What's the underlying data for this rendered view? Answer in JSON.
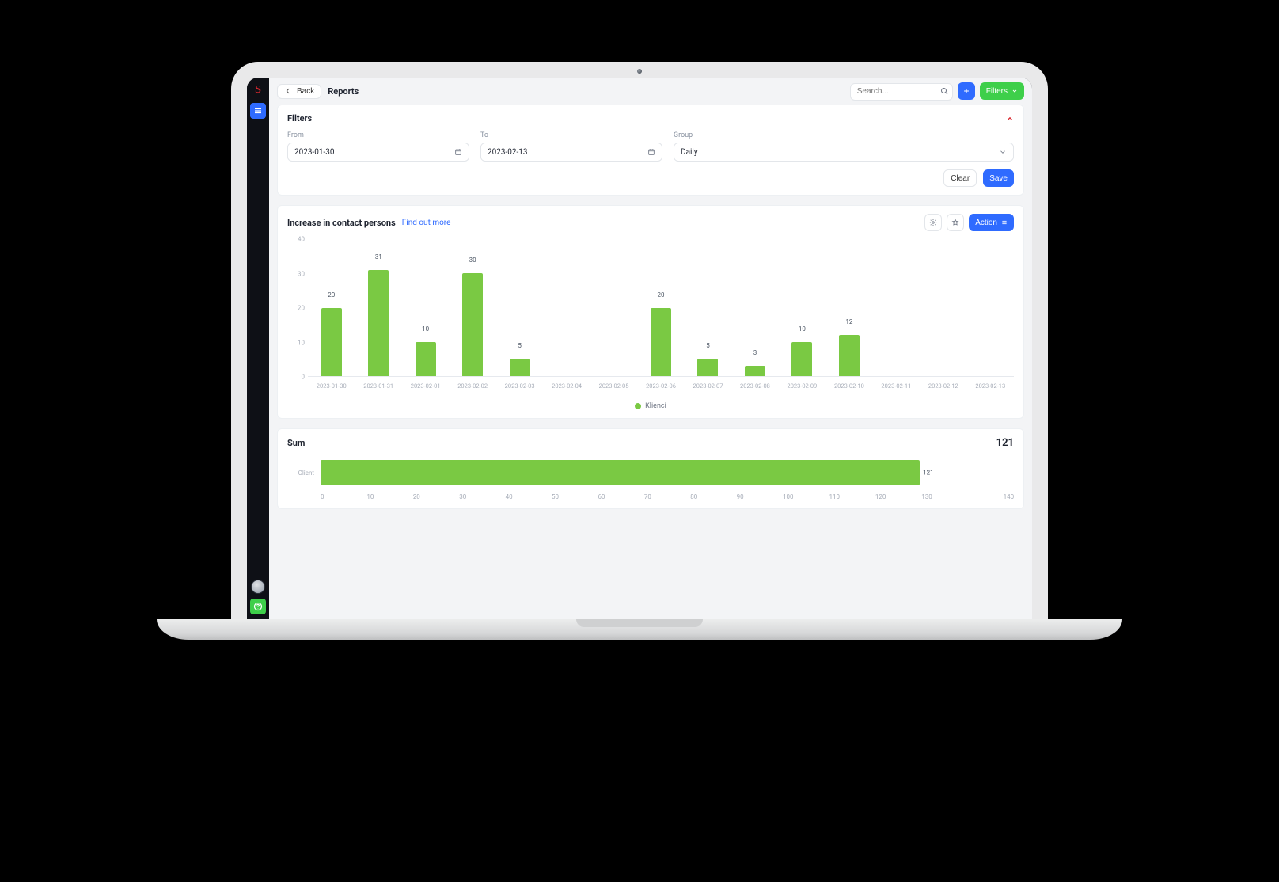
{
  "header": {
    "back_label": "Back",
    "breadcrumb": "Reports",
    "search_placeholder": "Search...",
    "filters_button": "Filters"
  },
  "filters_card": {
    "title": "Filters",
    "from_label": "From",
    "from_value": "2023-01-30",
    "to_label": "To",
    "to_value": "2023-02-13",
    "group_label": "Group",
    "group_value": "Daily",
    "clear_label": "Clear",
    "save_label": "Save"
  },
  "chart_card": {
    "title": "Increase in contact persons",
    "link": "Find out more",
    "action_label": "Action",
    "legend_label": "Klienci"
  },
  "sum_card": {
    "title": "Sum",
    "total": "121",
    "category_label": "Client",
    "value_label": "121"
  },
  "colors": {
    "bar": "#7ac943",
    "blue": "#2f6bff",
    "green_btn": "#3ecf4a",
    "red": "#d9272e"
  },
  "chart_data": [
    {
      "type": "bar",
      "title": "Increase in contact persons",
      "legend": [
        "Klienci"
      ],
      "ylabel": "",
      "ylim": [
        0,
        40
      ],
      "yticks": [
        0,
        10,
        20,
        30,
        40
      ],
      "categories": [
        "2023-01-30",
        "2023-01-31",
        "2023-02-01",
        "2023-02-02",
        "2023-02-03",
        "2023-02-04",
        "2023-02-05",
        "2023-02-06",
        "2023-02-07",
        "2023-02-08",
        "2023-02-09",
        "2023-02-10",
        "2023-02-11",
        "2023-02-12",
        "2023-02-13"
      ],
      "values": [
        20,
        31,
        10,
        30,
        5,
        0,
        0,
        20,
        5,
        3,
        10,
        12,
        0,
        0,
        0
      ]
    },
    {
      "type": "bar",
      "orientation": "horizontal",
      "title": "Sum",
      "categories": [
        "Client"
      ],
      "values": [
        121
      ],
      "xlim": [
        0,
        140
      ],
      "xticks": [
        0,
        10,
        20,
        30,
        40,
        50,
        60,
        70,
        80,
        90,
        100,
        110,
        120,
        130,
        140
      ]
    }
  ]
}
